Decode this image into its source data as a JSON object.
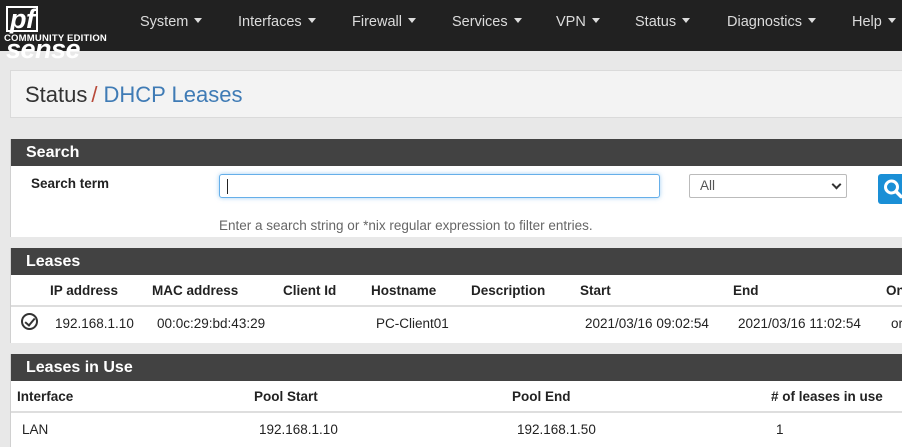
{
  "brand": {
    "logo_pf": "pf",
    "logo_sense": "sense",
    "edition": "COMMUNITY EDITION"
  },
  "nav": {
    "system": "System",
    "interfaces": "Interfaces",
    "firewall": "Firewall",
    "services": "Services",
    "vpn": "VPN",
    "status": "Status",
    "diagnostics": "Diagnostics",
    "help": "Help"
  },
  "breadcrumb": {
    "section": "Status",
    "separator": "/",
    "page": "DHCP Leases"
  },
  "search": {
    "title": "Search",
    "term_label": "Search term",
    "input_value": "",
    "filter_selected": "All",
    "help": "Enter a search string or *nix regular expression to filter entries."
  },
  "leases": {
    "title": "Leases",
    "columns": [
      "IP address",
      "MAC address",
      "Client Id",
      "Hostname",
      "Description",
      "Start",
      "End",
      "On"
    ],
    "rows": [
      {
        "ip": "192.168.1.10",
        "mac": "00:0c:29:bd:43:29",
        "client_id": "",
        "hostname": "PC-Client01",
        "description": "",
        "start": "2021/03/16 09:02:54",
        "end": "2021/03/16 11:02:54",
        "online": "or"
      }
    ]
  },
  "in_use": {
    "title": "Leases in Use",
    "columns": [
      "Interface",
      "Pool Start",
      "Pool End",
      "# of leases in use"
    ],
    "rows": [
      {
        "interface": "LAN",
        "pool_start": "192.168.1.10",
        "pool_end": "192.168.1.50",
        "count": "1"
      }
    ]
  },
  "colors": {
    "navbar": "#212121",
    "panel_header": "#424242",
    "link": "#3f7bb5",
    "slash": "#b84a3a",
    "search_button": "#1a8fd6"
  },
  "icons": [
    "search-icon",
    "online-status-icon",
    "caret-down-icon"
  ]
}
